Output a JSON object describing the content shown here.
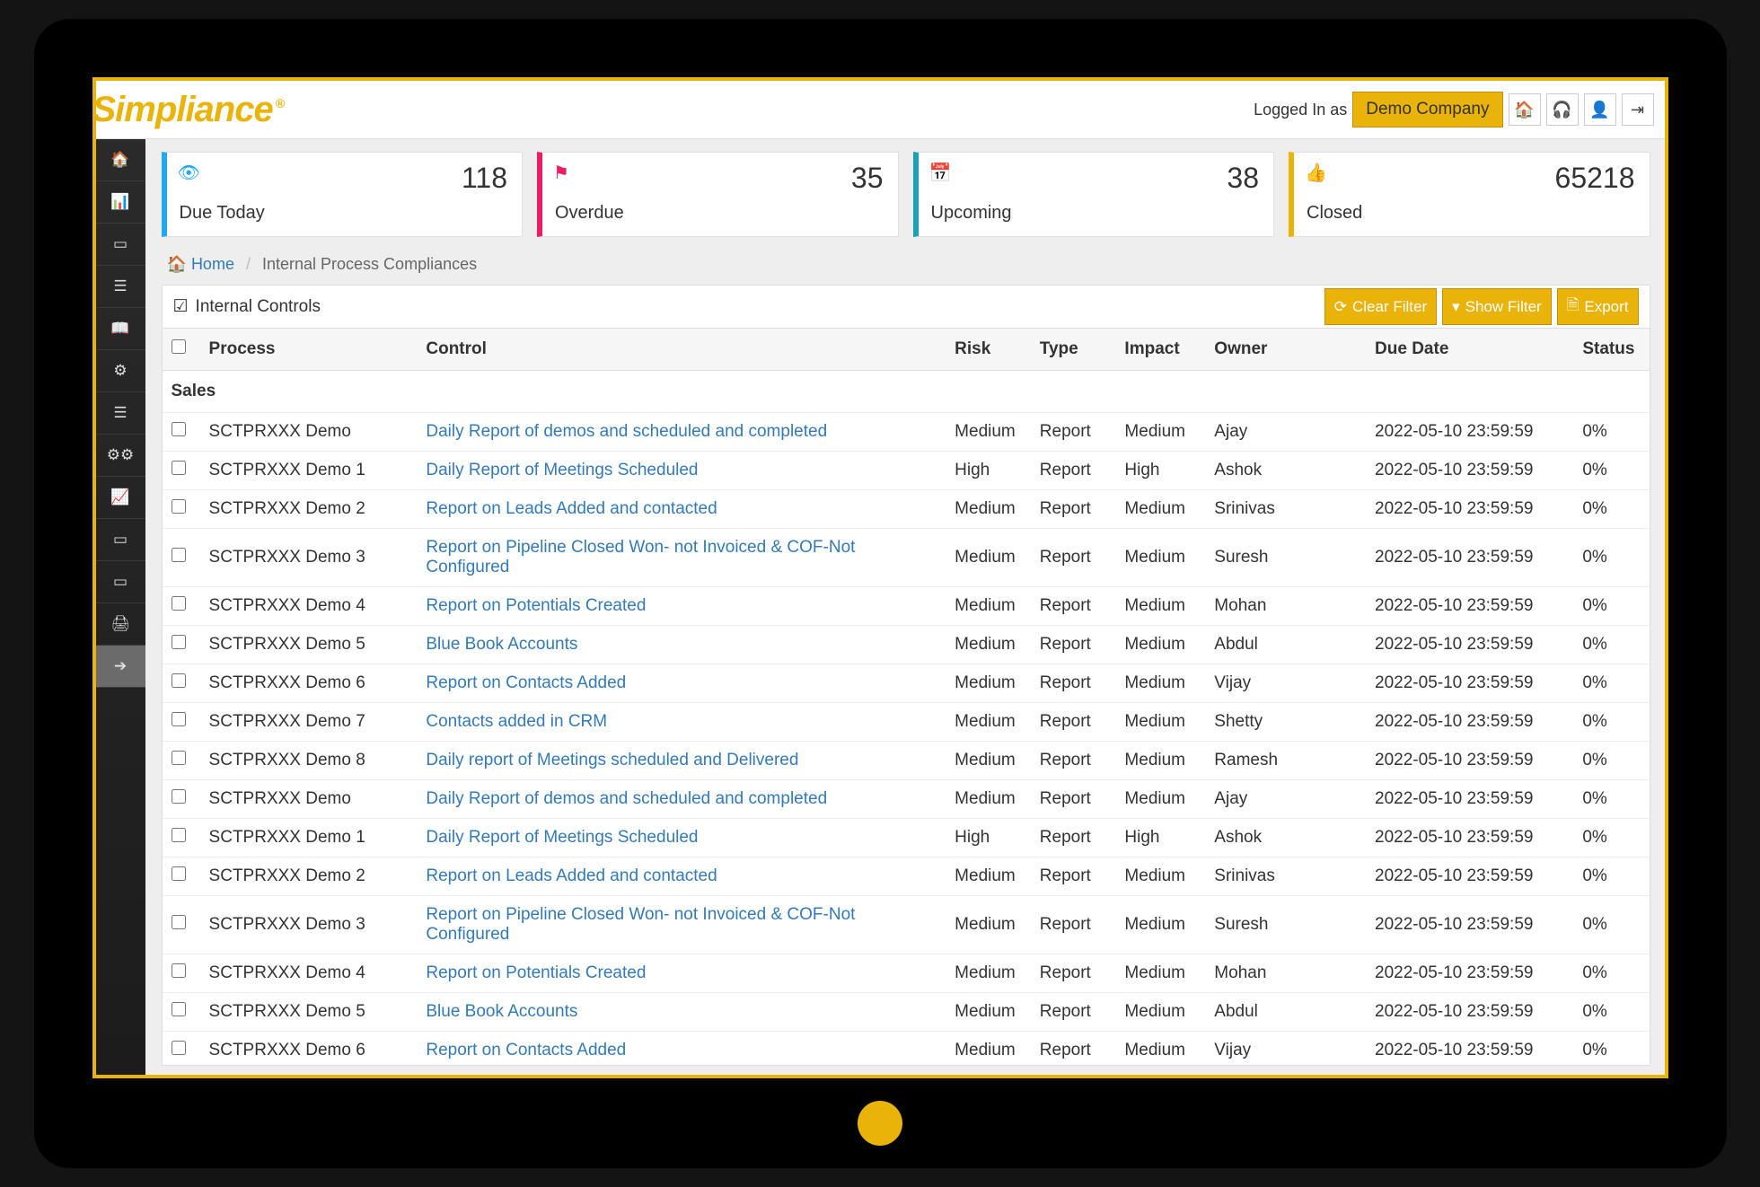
{
  "brand": "Simpliance",
  "header": {
    "logged_in_as": "Logged In as",
    "company": "Demo Company"
  },
  "kpis": [
    {
      "label": "Due Today",
      "value": "118",
      "icon": "👁",
      "cls": "blue"
    },
    {
      "label": "Overdue",
      "value": "35",
      "icon": "⚑",
      "cls": "pink"
    },
    {
      "label": "Upcoming",
      "value": "38",
      "icon": "📅",
      "cls": "teal"
    },
    {
      "label": "Closed",
      "value": "65218",
      "icon": "👍",
      "cls": "amber"
    }
  ],
  "breadcrumb": {
    "home": "Home",
    "current": "Internal Process Compliances"
  },
  "panel": {
    "title": "Internal Controls",
    "buttons": {
      "clear": "Clear Filter",
      "show": "Show Filter",
      "export": "Export"
    }
  },
  "columns": [
    "Process",
    "Control",
    "Risk",
    "Type",
    "Impact",
    "Owner",
    "Due Date",
    "Status"
  ],
  "group_label": "Sales",
  "rows": [
    {
      "process": "SCTPRXXX Demo",
      "control": "Daily Report of demos and scheduled and completed",
      "risk": "Medium",
      "type": "Report",
      "impact": "Medium",
      "owner": "Ajay",
      "due": "2022-05-10 23:59:59",
      "status": "0%"
    },
    {
      "process": "SCTPRXXX Demo 1",
      "control": "Daily Report of Meetings Scheduled",
      "risk": "High",
      "type": "Report",
      "impact": "High",
      "owner": "Ashok",
      "due": "2022-05-10 23:59:59",
      "status": "0%"
    },
    {
      "process": "SCTPRXXX Demo 2",
      "control": "Report on Leads Added and contacted",
      "risk": "Medium",
      "type": "Report",
      "impact": "Medium",
      "owner": "Srinivas",
      "due": "2022-05-10 23:59:59",
      "status": "0%"
    },
    {
      "process": "SCTPRXXX Demo 3",
      "control": "Report on Pipeline Closed Won- not Invoiced & COF-Not Configured",
      "risk": "Medium",
      "type": "Report",
      "impact": "Medium",
      "owner": "Suresh",
      "due": "2022-05-10 23:59:59",
      "status": "0%"
    },
    {
      "process": "SCTPRXXX Demo 4",
      "control": "Report on Potentials Created",
      "risk": "Medium",
      "type": "Report",
      "impact": "Medium",
      "owner": "Mohan",
      "due": "2022-05-10 23:59:59",
      "status": "0%"
    },
    {
      "process": "SCTPRXXX Demo 5",
      "control": "Blue Book Accounts",
      "risk": "Medium",
      "type": "Report",
      "impact": "Medium",
      "owner": "Abdul",
      "due": "2022-05-10 23:59:59",
      "status": "0%"
    },
    {
      "process": "SCTPRXXX Demo 6",
      "control": "Report on Contacts Added",
      "risk": "Medium",
      "type": "Report",
      "impact": "Medium",
      "owner": "Vijay",
      "due": "2022-05-10 23:59:59",
      "status": "0%"
    },
    {
      "process": "SCTPRXXX Demo 7",
      "control": "Contacts added in CRM",
      "risk": "Medium",
      "type": "Report",
      "impact": "Medium",
      "owner": "Shetty",
      "due": "2022-05-10 23:59:59",
      "status": "0%"
    },
    {
      "process": "SCTPRXXX Demo 8",
      "control": "Daily report of Meetings scheduled and Delivered",
      "risk": "Medium",
      "type": "Report",
      "impact": "Medium",
      "owner": "Ramesh",
      "due": "2022-05-10 23:59:59",
      "status": "0%"
    },
    {
      "process": "SCTPRXXX Demo",
      "control": "Daily Report of demos and scheduled and completed",
      "risk": "Medium",
      "type": "Report",
      "impact": "Medium",
      "owner": "Ajay",
      "due": "2022-05-10 23:59:59",
      "status": "0%"
    },
    {
      "process": "SCTPRXXX Demo 1",
      "control": "Daily Report of Meetings Scheduled",
      "risk": "High",
      "type": "Report",
      "impact": "High",
      "owner": "Ashok",
      "due": "2022-05-10 23:59:59",
      "status": "0%"
    },
    {
      "process": "SCTPRXXX Demo 2",
      "control": "Report on Leads Added and contacted",
      "risk": "Medium",
      "type": "Report",
      "impact": "Medium",
      "owner": "Srinivas",
      "due": "2022-05-10 23:59:59",
      "status": "0%"
    },
    {
      "process": "SCTPRXXX Demo 3",
      "control": "Report on Pipeline Closed Won- not Invoiced & COF-Not Configured",
      "risk": "Medium",
      "type": "Report",
      "impact": "Medium",
      "owner": "Suresh",
      "due": "2022-05-10 23:59:59",
      "status": "0%"
    },
    {
      "process": "SCTPRXXX Demo 4",
      "control": "Report on Potentials Created",
      "risk": "Medium",
      "type": "Report",
      "impact": "Medium",
      "owner": "Mohan",
      "due": "2022-05-10 23:59:59",
      "status": "0%"
    },
    {
      "process": "SCTPRXXX Demo 5",
      "control": "Blue Book Accounts",
      "risk": "Medium",
      "type": "Report",
      "impact": "Medium",
      "owner": "Abdul",
      "due": "2022-05-10 23:59:59",
      "status": "0%"
    },
    {
      "process": "SCTPRXXX Demo 6",
      "control": "Report on Contacts Added",
      "risk": "Medium",
      "type": "Report",
      "impact": "Medium",
      "owner": "Vijay",
      "due": "2022-05-10 23:59:59",
      "status": "0%"
    }
  ]
}
